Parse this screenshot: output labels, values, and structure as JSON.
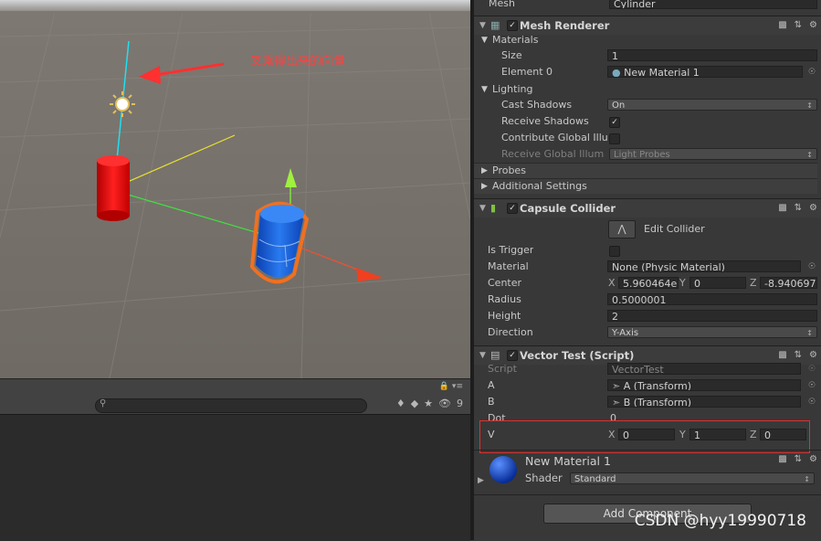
{
  "scene": {
    "annotation": "叉乘得出来的向量"
  },
  "bottom_panel": {
    "hidden_count": "9"
  },
  "inspector": {
    "mesh": {
      "label": "Mesh",
      "value": "Cylinder"
    },
    "mesh_renderer": {
      "title": "Mesh Renderer",
      "materials_header": "Materials",
      "size_label": "Size",
      "size_value": "1",
      "element0_label": "Element 0",
      "element0_value": "New Material 1",
      "lighting_header": "Lighting",
      "cast_shadows_label": "Cast Shadows",
      "cast_shadows_value": "On",
      "receive_shadows_label": "Receive Shadows",
      "contribute_gi_label": "Contribute Global Illu",
      "receive_gi_label": "Receive Global Illum",
      "receive_gi_value": "Light Probes",
      "probes_header": "Probes",
      "additional_header": "Additional Settings"
    },
    "capsule_collider": {
      "title": "Capsule Collider",
      "edit_label": "Edit Collider",
      "is_trigger_label": "Is Trigger",
      "material_label": "Material",
      "material_value": "None (Physic Material)",
      "center_label": "Center",
      "center_x": "5.960464e",
      "center_y": "0",
      "center_z": "-8.940697",
      "radius_label": "Radius",
      "radius_value": "0.5000001",
      "height_label": "Height",
      "height_value": "2",
      "direction_label": "Direction",
      "direction_value": "Y-Axis"
    },
    "vector_test": {
      "title": "Vector Test (Script)",
      "script_label": "Script",
      "script_value": "VectorTest",
      "a_label": "A",
      "a_value": "A (Transform)",
      "b_label": "B",
      "b_value": "B (Transform)",
      "dot_label": "Dot",
      "dot_value": "0",
      "v_label": "V",
      "v_x": "0",
      "v_y": "1",
      "v_z": "0"
    },
    "material": {
      "name": "New Material 1",
      "shader_label": "Shader",
      "shader_value": "Standard"
    },
    "add_component": "Add Component",
    "axis_x": "X",
    "axis_y": "Y",
    "axis_z": "Z"
  },
  "watermark": "CSDN @hyy19990718"
}
